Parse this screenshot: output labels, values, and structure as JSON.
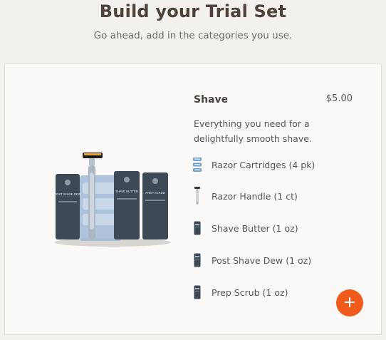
{
  "header": {
    "title": "Build your Trial Set",
    "subtitle": "Go ahead, add in the categories you use."
  },
  "category": {
    "name": "Shave",
    "price": "$5.00",
    "description": "Everything you need for a delightfully smooth shave.",
    "image_icon": "shave-kit-product-image",
    "items": [
      {
        "label": "Razor Cartridges (4 pk)",
        "icon": "razor-cartridge-icon"
      },
      {
        "label": "Razor Handle (1 ct)",
        "icon": "razor-handle-icon"
      },
      {
        "label": "Shave Butter (1 oz)",
        "icon": "tube-icon"
      },
      {
        "label": "Post Shave Dew (1 oz)",
        "icon": "tube-icon"
      },
      {
        "label": "Prep Scrub (1 oz)",
        "icon": "tube-icon"
      }
    ]
  },
  "product_tubes": [
    "POST SHAVE DEW",
    "SHAVE BUTTER",
    "PREP SCRUB"
  ],
  "add_button": {
    "icon": "plus-icon"
  },
  "colors": {
    "accent": "#f05a1a",
    "tube": "#3d4a55",
    "background": "#f3f1ee"
  }
}
